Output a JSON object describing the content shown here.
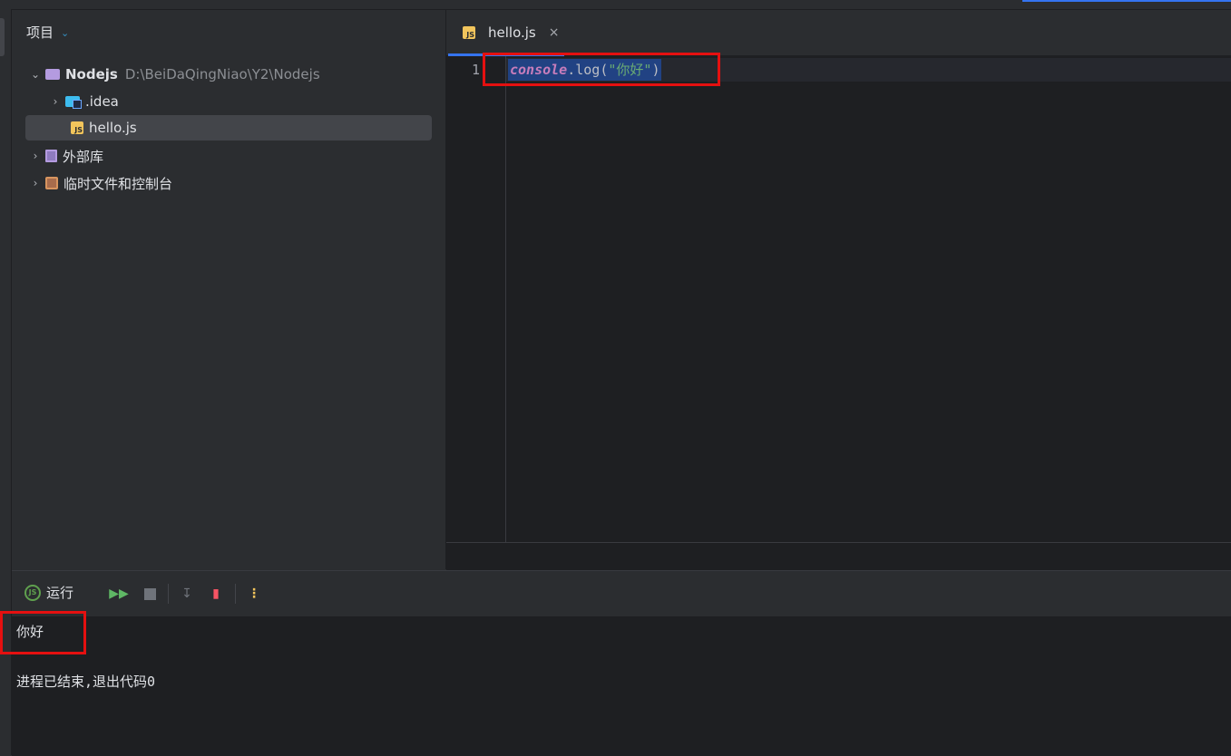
{
  "project_panel": {
    "title": "项目",
    "tree": [
      {
        "name": "Nodejs",
        "path": "D:\\BeiDaQingNiao\\Y2\\Nodejs",
        "icon": "folder-icon"
      },
      {
        "name": ".idea",
        "icon": "idea-folder-icon"
      },
      {
        "name": "hello.js",
        "icon": "js-file-icon"
      },
      {
        "name": "外部库",
        "icon": "library-icon"
      },
      {
        "name": "临时文件和控制台",
        "icon": "scratch-icon"
      }
    ]
  },
  "editor": {
    "tab_label": "hello.js",
    "line_number": "1",
    "code": {
      "object": "console",
      "dot": ".",
      "method": "log(",
      "string": "\"你好\"",
      "close": ")"
    }
  },
  "run_panel": {
    "title": "运行",
    "output": [
      "你好",
      "进程已结束,退出代码0"
    ]
  },
  "colors": {
    "accent": "#3574f0",
    "highlight_box": "#e51010",
    "selection": "#214283"
  }
}
